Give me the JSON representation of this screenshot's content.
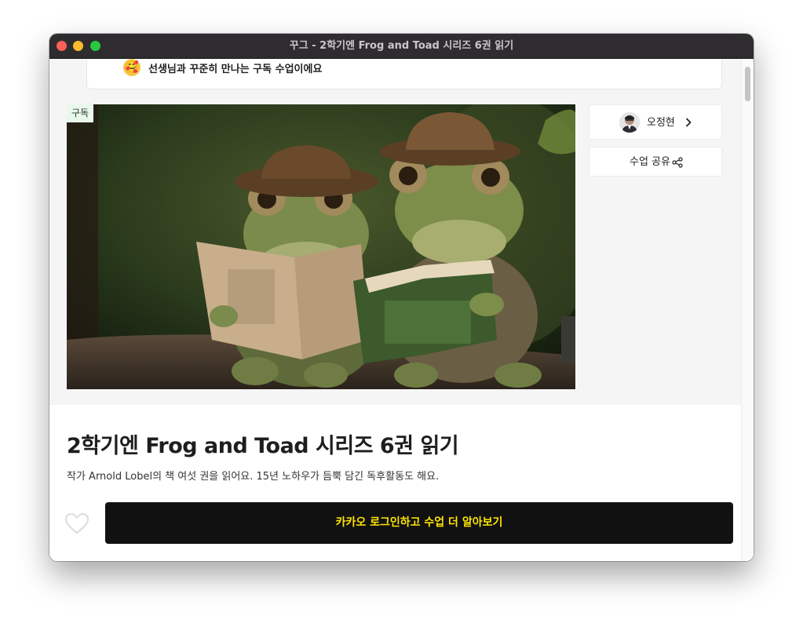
{
  "window": {
    "title": "꾸그 - 2학기엔 Frog and Toad 시리즈 6권 읽기"
  },
  "notice": {
    "emoji": "🥰",
    "text": "선생님과 꾸준히 만나는 구독 수업이에요"
  },
  "hero": {
    "badge": "구독"
  },
  "teacher": {
    "name": "오정현"
  },
  "share": {
    "label": "수업 공유"
  },
  "course": {
    "title": "2학기엔 Frog and Toad 시리즈 6권 읽기",
    "description": "작가 Arnold Lobel의 책 여섯 권을 읽어요. 15년 노하우가 듬뿍 담긴 독후활동도 해요."
  },
  "cta": {
    "label": "카카오 로그인하고 수업 더 알아보기"
  },
  "colors": {
    "cta_background": "#111111",
    "cta_text": "#fee500",
    "badge_background": "#e9f7ec"
  }
}
